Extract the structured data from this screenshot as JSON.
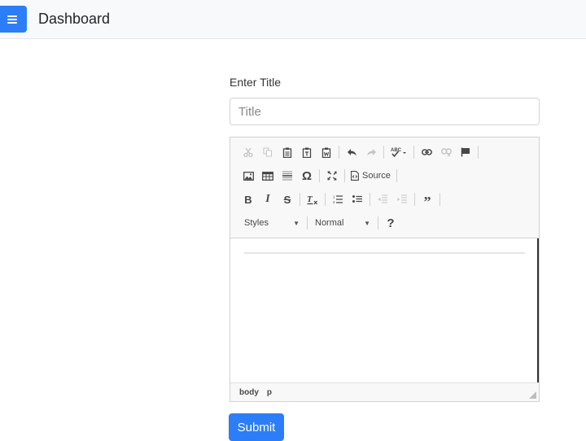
{
  "navbar": {
    "menu_icon": "hamburger-icon",
    "title": "Dashboard"
  },
  "form": {
    "title_label": "Enter Title",
    "title_input": {
      "value": "",
      "placeholder": "Title"
    },
    "submit_label": "Submit"
  },
  "editor": {
    "toolbar_rows": [
      [
        "cut",
        "copy",
        "paste",
        "paste-as-text",
        "paste-from-word",
        "undo",
        "redo",
        "spellcheck",
        "link",
        "unlink",
        "anchor"
      ],
      [
        "image",
        "table",
        "horizontal-line",
        "special-character",
        "maximize",
        "source"
      ],
      [
        "bold",
        "italic",
        "strikethrough",
        "remove-format",
        "numbered-list",
        "bulleted-list",
        "decrease-indent",
        "increase-indent",
        "blockquote"
      ],
      [
        "styles",
        "format",
        "about"
      ]
    ],
    "source_label": "Source",
    "styles_label": "Styles",
    "format_label": "Normal",
    "about_label": "?",
    "path": [
      "body",
      "p"
    ]
  },
  "colors": {
    "accent": "#2c7ef8",
    "navbar_bg": "#f8f9fa",
    "toolbar_bg": "#f8f8f8"
  }
}
